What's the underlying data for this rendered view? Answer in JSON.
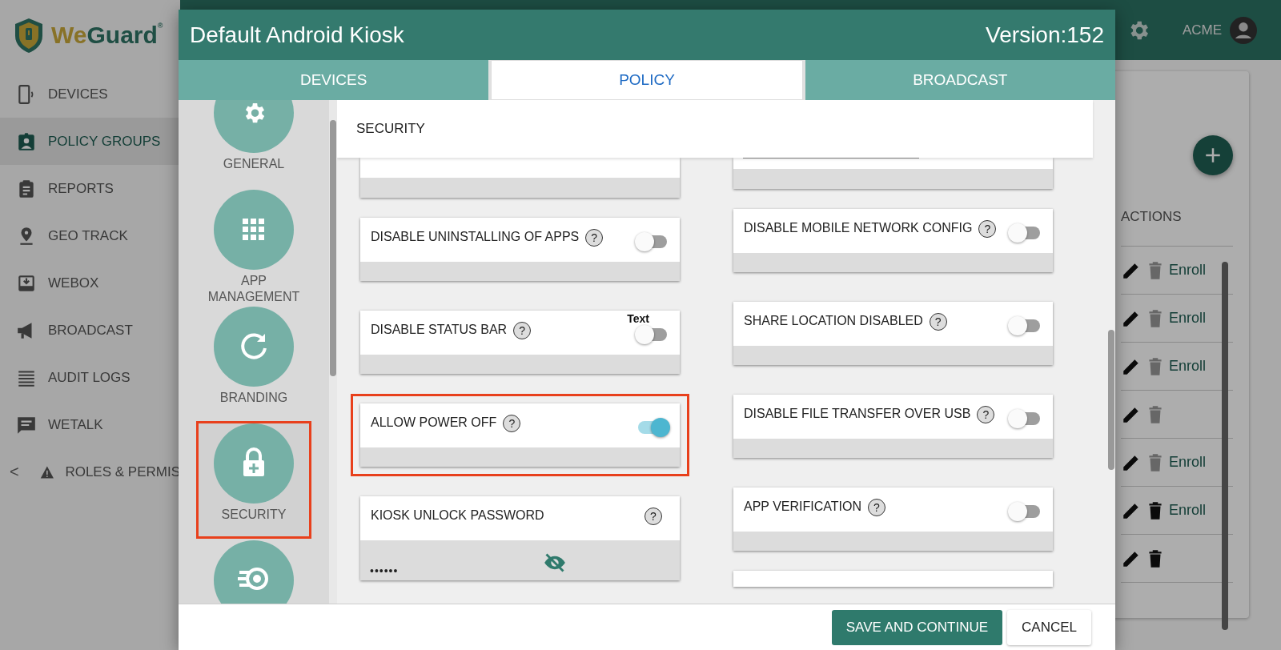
{
  "brand": {
    "name_part1": "We",
    "name_part2": "Guard",
    "mark": "®"
  },
  "sidebar": {
    "items": [
      {
        "label": "DEVICES",
        "selected": false
      },
      {
        "label": "POLICY GROUPS",
        "selected": true
      },
      {
        "label": "REPORTS",
        "selected": false
      },
      {
        "label": "GEO TRACK",
        "selected": false
      },
      {
        "label": "WEBOX",
        "selected": false
      },
      {
        "label": "BROADCAST",
        "selected": false
      },
      {
        "label": "AUDIT LOGS",
        "selected": false
      },
      {
        "label": "WETALK",
        "selected": false
      },
      {
        "label": "ROLES & PERMIS",
        "selected": false
      }
    ],
    "collapse": "<"
  },
  "topbar": {
    "user": "ACME"
  },
  "actions_table": {
    "header": "ACTIONS",
    "rows": [
      {
        "delete_enabled": false,
        "enroll": "Enroll"
      },
      {
        "delete_enabled": false,
        "enroll": "Enroll"
      },
      {
        "delete_enabled": false,
        "enroll": "Enroll"
      },
      {
        "delete_enabled": false
      },
      {
        "delete_enabled": false,
        "enroll": "Enroll"
      },
      {
        "delete_enabled": true,
        "enroll": "Enroll"
      },
      {
        "delete_enabled": true
      }
    ]
  },
  "dialog": {
    "title": "Default Android Kiosk",
    "version": "Version:152",
    "tabs": [
      {
        "label": "DEVICES",
        "selected": false
      },
      {
        "label": "POLICY",
        "selected": true
      },
      {
        "label": "BROADCAST",
        "selected": false
      }
    ],
    "nav": [
      {
        "label": "GENERAL",
        "highlighted": false
      },
      {
        "label": "APP MANAGEMENT",
        "highlighted": false
      },
      {
        "label": "BRANDING",
        "highlighted": false
      },
      {
        "label": "SECURITY",
        "highlighted": true
      },
      {
        "highlighted": false
      }
    ],
    "section": "SECURITY",
    "left_settings": [
      {
        "kind": "toggle",
        "label": "DISABLE UNINSTALLING OF APPS",
        "on": false,
        "highlighted": false
      },
      {
        "kind": "toggle",
        "label": "DISABLE STATUS BAR",
        "note": "Text",
        "on": false,
        "highlighted": false
      },
      {
        "kind": "toggle",
        "label": "ALLOW POWER OFF",
        "on": true,
        "highlighted": true
      },
      {
        "kind": "password",
        "label": "KIOSK UNLOCK PASSWORD",
        "value": "••••••"
      }
    ],
    "right_settings": [
      {
        "kind": "toggle",
        "label": "DISABLE MOBILE NETWORK CONFIG",
        "on": false,
        "highlighted": false
      },
      {
        "kind": "toggle",
        "label": "SHARE LOCATION DISABLED",
        "on": false,
        "highlighted": false
      },
      {
        "kind": "toggle",
        "label": "DISABLE FILE TRANSFER OVER USB",
        "on": false,
        "highlighted": false
      },
      {
        "kind": "toggle",
        "label": "APP VERIFICATION",
        "on": false,
        "highlighted": false
      }
    ],
    "help": "?",
    "buttons": [
      {
        "label": "SAVE AND CONTINUE",
        "kind": "primary"
      },
      {
        "label": "CANCEL",
        "kind": "secondary"
      }
    ]
  }
}
